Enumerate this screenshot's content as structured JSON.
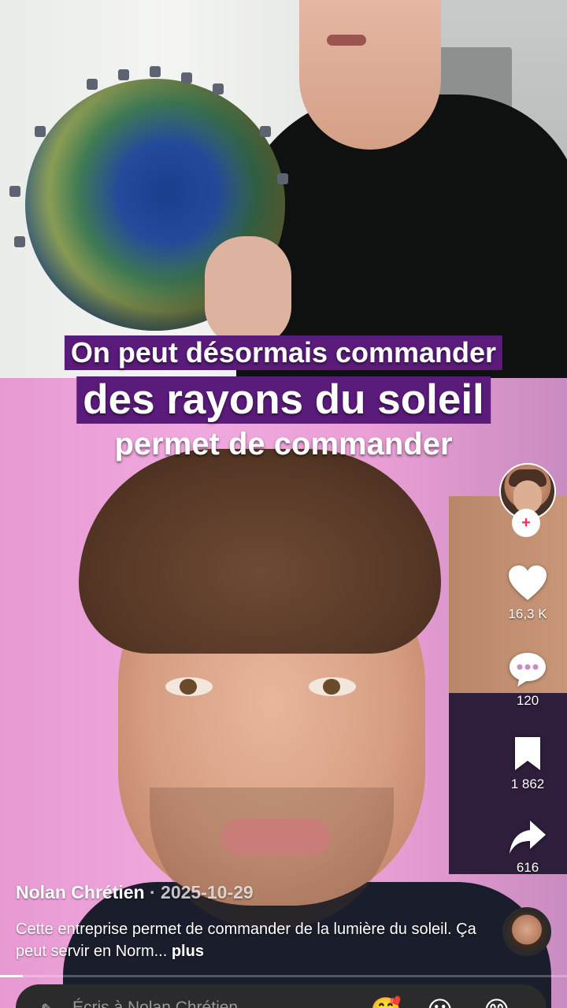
{
  "captions": {
    "line1": "On peut désormais commander",
    "line2": "des rayons du soleil",
    "line3": "permet de commander"
  },
  "actions": {
    "follow_icon": "plus-icon",
    "likes": "16,3 K",
    "comments": "120",
    "saves": "1 862",
    "shares": "616"
  },
  "post": {
    "author": "Nolan Chrétien",
    "date_sep": " · ",
    "date": "2025-10-29",
    "description": "Cette entreprise permet de commander de la lumière du soleil. Ça peut servir en Norm... ",
    "more": "plus"
  },
  "comment_bar": {
    "placeholder": "Écris à Nolan Chrétien...",
    "emojis": [
      "🥰",
      "😮",
      "😊"
    ]
  },
  "colors": {
    "caption_band": "#5a1b7a",
    "tiktok_red": "#fe2c55"
  }
}
